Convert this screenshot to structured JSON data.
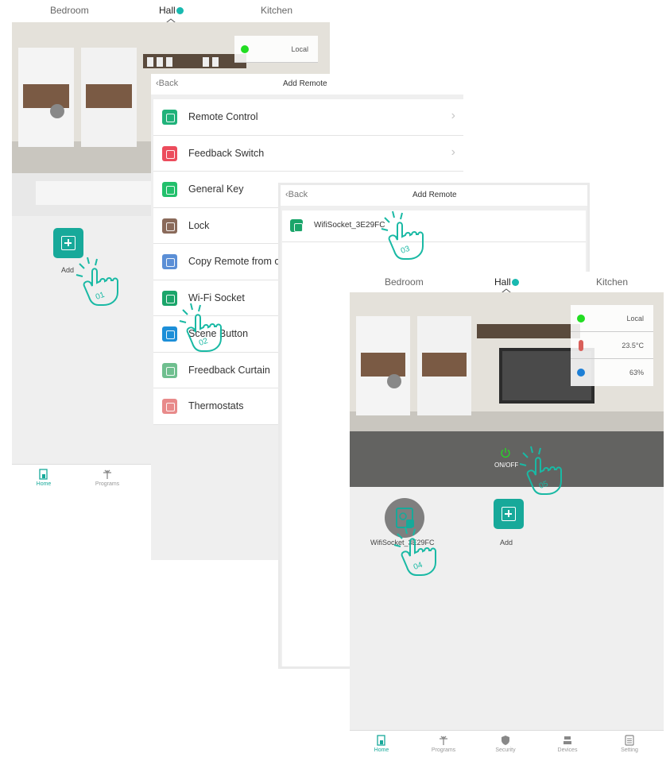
{
  "screen1": {
    "tabs": [
      "Bedroom",
      "Hall",
      "Kitchen"
    ],
    "status": {
      "mode": "Local"
    },
    "add_label": "Add",
    "nav": [
      {
        "label": "Home",
        "icon": "home-icon"
      },
      {
        "label": "Programs",
        "icon": "programs-icon"
      }
    ]
  },
  "screen2": {
    "back_label": "Back",
    "title": "Add Remote",
    "items": [
      {
        "label": "Remote Control",
        "icon": "remote-control-icon",
        "color": "#20b27a",
        "chevron": true
      },
      {
        "label": "Feedback Switch",
        "icon": "feedback-switch-icon",
        "color": "#ec4c5c",
        "chevron": true
      },
      {
        "label": "General Key",
        "icon": "general-key-icon",
        "color": "#22c06c",
        "chevron": false
      },
      {
        "label": "Lock",
        "icon": "lock-icon",
        "color": "#8a6a5a",
        "chevron": false
      },
      {
        "label": "Copy Remote from ot",
        "icon": "copy-remote-icon",
        "color": "#5b8fd6",
        "chevron": false
      },
      {
        "label": "Wi-Fi Socket",
        "icon": "wifi-socket-icon",
        "color": "#1aa56a",
        "chevron": false
      },
      {
        "label": "Scene Button",
        "icon": "scene-button-icon",
        "color": "#1d8fd8",
        "chevron": false
      },
      {
        "label": "Freedback Curtain",
        "icon": "curtain-icon",
        "color": "#6fbf8f",
        "chevron": false
      },
      {
        "label": "Thermostats",
        "icon": "thermostat-icon",
        "color": "#e88a8a",
        "chevron": false
      }
    ]
  },
  "screen3": {
    "back_label": "Back",
    "title": "Add Remote",
    "device": "WifiSocket_3E29FC"
  },
  "screen4": {
    "tabs": [
      "Bedroom",
      "Hall",
      "Kitchen"
    ],
    "status": {
      "mode": "Local",
      "temperature": "23.5°C",
      "humidity": "63%"
    },
    "onoff_label": "ON/OFF",
    "device_label": "WifiSocket_3E29FC",
    "add_label": "Add",
    "nav": [
      {
        "label": "Home",
        "icon": "home-icon"
      },
      {
        "label": "Programs",
        "icon": "programs-icon"
      },
      {
        "label": "Security",
        "icon": "security-icon"
      },
      {
        "label": "Devices",
        "icon": "devices-icon"
      },
      {
        "label": "Setting",
        "icon": "setting-icon"
      }
    ]
  },
  "steps": [
    "01",
    "02",
    "03",
    "04",
    "05"
  ],
  "colors": {
    "accent": "#17a99a",
    "background": "#efefef",
    "status_green": "#22dd22"
  }
}
